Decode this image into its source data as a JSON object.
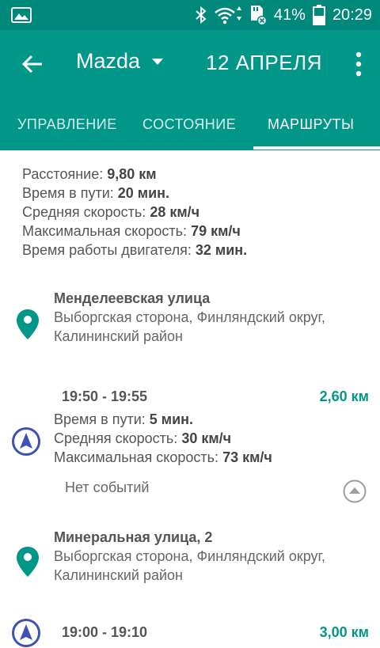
{
  "status_bar": {
    "battery": "41%",
    "time": "20:29"
  },
  "app_bar": {
    "car": "Mazda",
    "date": "12 АПРЕЛЯ"
  },
  "tabs": [
    {
      "label": "УПРАВЛЕНИЕ"
    },
    {
      "label": "СОСТОЯНИЕ"
    },
    {
      "label": "МАРШРУТЫ"
    }
  ],
  "summary": {
    "distance_label": "Расстояние:",
    "distance": "9,80 км",
    "time_label": "Время в пути:",
    "time": "20 мин.",
    "avg_label": "Средняя скорость:",
    "avg": "28 км/ч",
    "max_label": "Максимальная скорость:",
    "max": "79 км/ч",
    "engine_label": "Время работы двигателя:",
    "engine": "32 мин."
  },
  "stops": [
    {
      "title": "Менделеевская улица",
      "address": "Выборгская сторона, Финляндский округ, Калининский район"
    },
    {
      "title": "Минеральная улица, 2",
      "address": "Выборгская сторона, Финляндский округ, Калининский район"
    }
  ],
  "segments": [
    {
      "time": "19:50 - 19:55",
      "distance": "2,60 км",
      "time_label": "Время в пути:",
      "duration": "5 мин.",
      "avg_label": "Средняя скорость:",
      "avg": "30 км/ч",
      "max_label": "Максимальная скорость:",
      "max": "73 км/ч",
      "events": "Нет событий"
    },
    {
      "time": "19:00 - 19:10",
      "distance": "3,00 км"
    }
  ],
  "colors": {
    "primary": "#009688",
    "status": "#00897b",
    "nav_icon": "#3f51b5"
  }
}
